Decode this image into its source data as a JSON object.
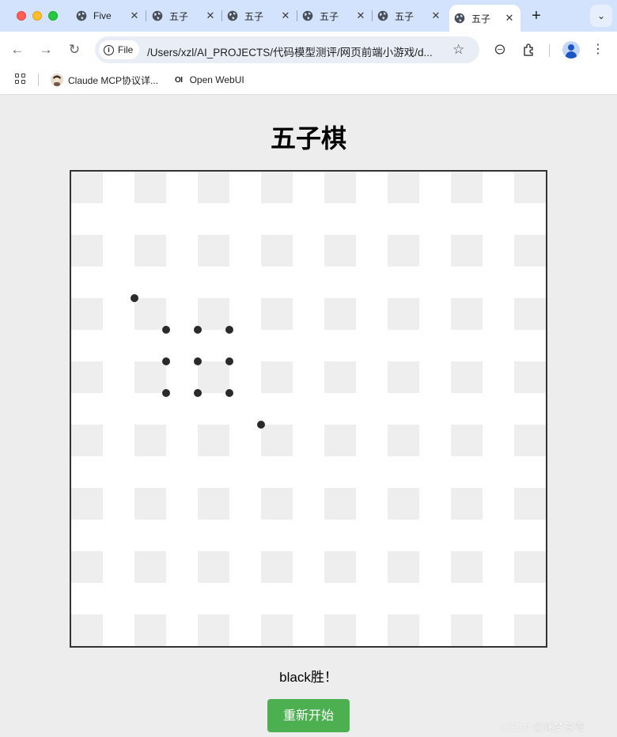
{
  "browser": {
    "tabs": [
      {
        "label": "Five",
        "active": false
      },
      {
        "label": "五子",
        "active": false
      },
      {
        "label": "五子",
        "active": false
      },
      {
        "label": "五子",
        "active": false
      },
      {
        "label": "五子",
        "active": false
      },
      {
        "label": "五子",
        "active": true
      }
    ],
    "new_tab_label": "+",
    "tab_menu_label": "⌄",
    "chip_label": "File",
    "url": "/Users/xzl/AI_PROJECTS/代码模型测评/网页前端小游戏/d...",
    "bookmarks": [
      {
        "label": "Claude MCP协议详..."
      },
      {
        "label": "Open WebUI",
        "icon_text": "OI"
      }
    ]
  },
  "page": {
    "title": "五子棋",
    "status": "black胜！",
    "restart_label": "重新开始",
    "watermark": "CSDN @逐梦苍穹"
  },
  "board": {
    "size": 15,
    "stones": [
      {
        "row": 4,
        "col": 2,
        "color": "black"
      },
      {
        "row": 5,
        "col": 3,
        "color": "black"
      },
      {
        "row": 5,
        "col": 4,
        "color": "black"
      },
      {
        "row": 5,
        "col": 5,
        "color": "black"
      },
      {
        "row": 6,
        "col": 3,
        "color": "black"
      },
      {
        "row": 6,
        "col": 4,
        "color": "black"
      },
      {
        "row": 6,
        "col": 5,
        "color": "black"
      },
      {
        "row": 7,
        "col": 3,
        "color": "black"
      },
      {
        "row": 7,
        "col": 4,
        "color": "black"
      },
      {
        "row": 7,
        "col": 5,
        "color": "black"
      },
      {
        "row": 8,
        "col": 6,
        "color": "black"
      }
    ]
  },
  "colors": {
    "tab_strip": "#d3e3fd",
    "button_green": "#4caf50",
    "cell_shade": "#eeeeee",
    "stone": "#2a2a2a"
  }
}
